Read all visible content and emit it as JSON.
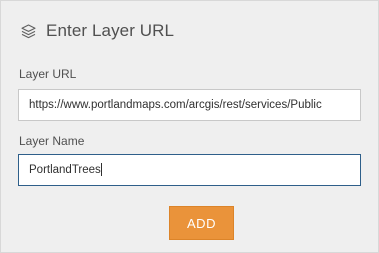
{
  "header": {
    "icon": "layers-icon",
    "title": "Enter Layer URL"
  },
  "layer_url": {
    "label": "Layer URL",
    "value": "https://www.portlandmaps.com/arcgis/rest/services/Public"
  },
  "layer_name": {
    "label": "Layer Name",
    "value": "PortlandTrees"
  },
  "add_button": {
    "label": "ADD"
  },
  "colors": {
    "accent": "#ea933a",
    "focus_border": "#2e5f8a",
    "text": "#505050"
  }
}
